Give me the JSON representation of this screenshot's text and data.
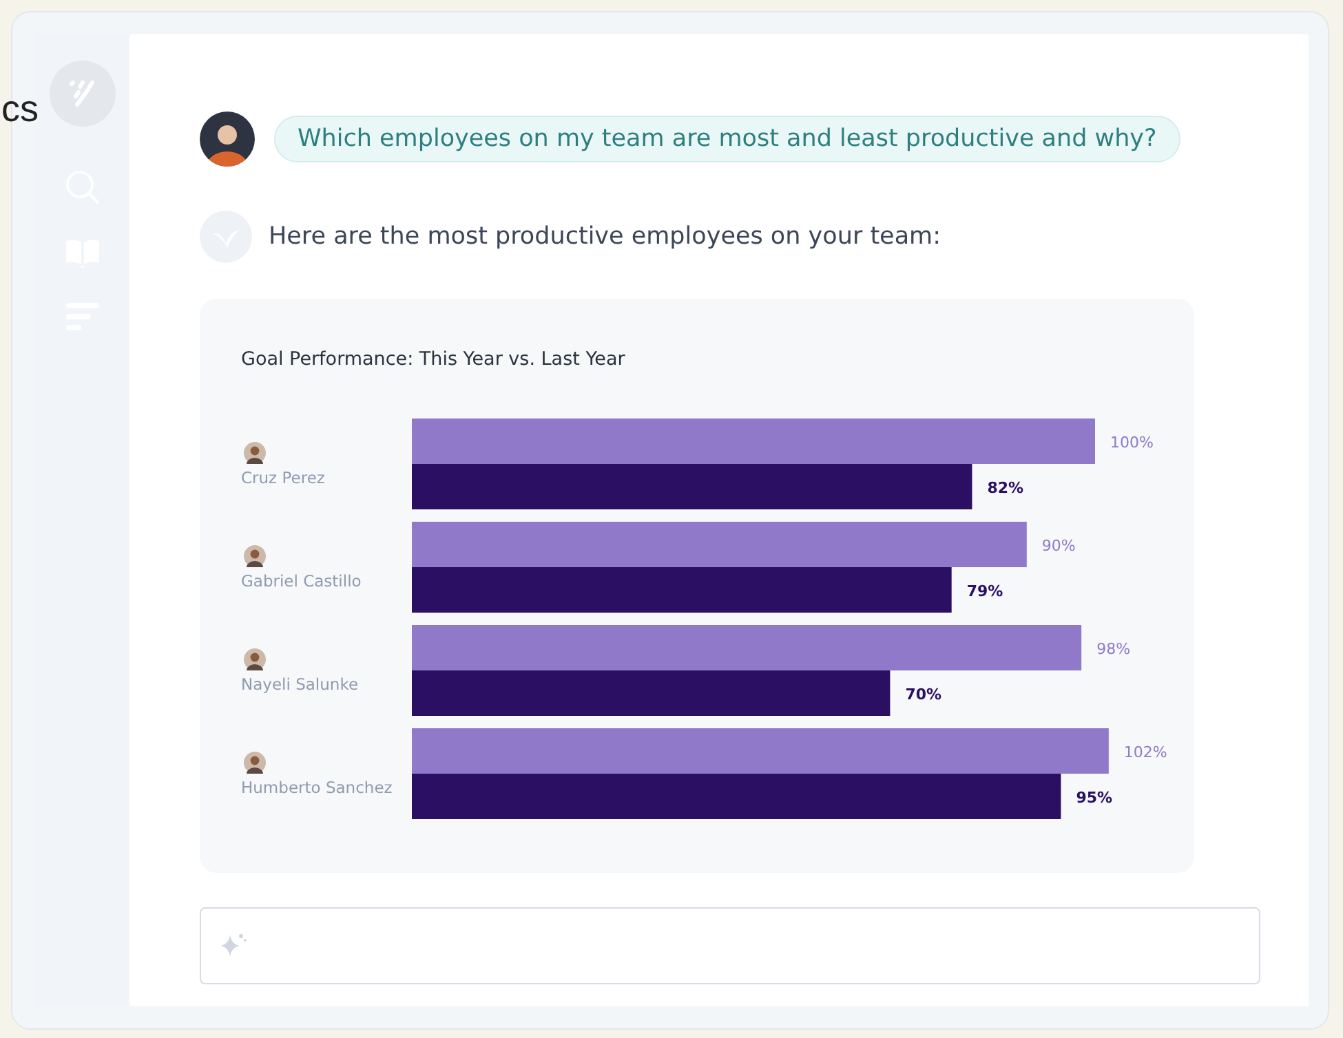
{
  "backdrop_text": "cs",
  "conversation": [
    {
      "kind": "user",
      "text": "Which employees on my team are most and least productive and why?"
    },
    {
      "kind": "assistant",
      "text": "Here are the most productive employees on your team:"
    }
  ],
  "chart": {
    "chart_data": {
      "type": "bar",
      "orientation": "horizontal",
      "title": "Goal Performance: This Year vs. Last Year",
      "categories": [
        "Cruz Perez",
        "Gabriel Castillo",
        "Nayeli Salunke",
        "Humberto Sanchez"
      ],
      "series": [
        {
          "color": "#9079c9",
          "values": [
            100,
            90,
            98,
            102
          ],
          "value_labels": [
            "100%",
            "90%",
            "98%",
            "102%"
          ]
        },
        {
          "color": "#2a0f63",
          "values": [
            82,
            79,
            70,
            95
          ],
          "value_labels": [
            "82%",
            "79%",
            "70%",
            "95%"
          ]
        }
      ]
    }
  }
}
